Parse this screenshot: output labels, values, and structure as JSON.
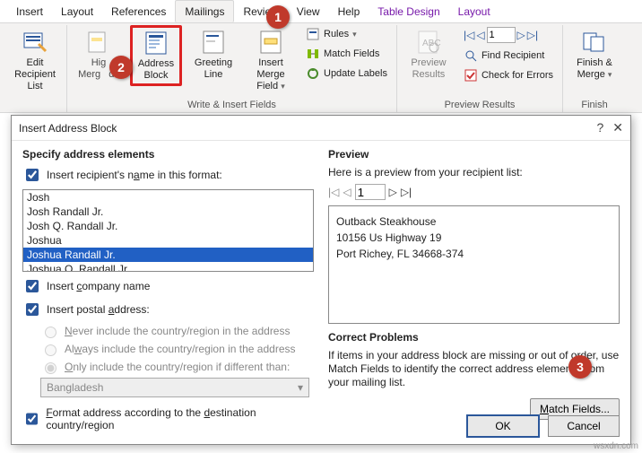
{
  "tabs": {
    "insert": "Insert",
    "layout": "Layout",
    "references": "References",
    "mailings": "Mailings",
    "review": "Review",
    "view": "View",
    "help": "Help",
    "tabledesign": "Table Design",
    "layout2": "Layout"
  },
  "ribbon": {
    "edit_recipient_list": "Edit Recipient List",
    "highlight_merge": "Highlight Merge Fields",
    "address_block": "Address Block",
    "greeting_line": "Greeting Line",
    "insert_merge_field": "Insert Merge Field",
    "rules": "Rules",
    "match_fields": "Match Fields",
    "update_labels": "Update Labels",
    "preview_results": "Preview Results",
    "record_value": "1",
    "find_recipient": "Find Recipient",
    "check_errors": "Check for Errors",
    "finish_merge": "Finish & Merge",
    "group_write": "Write & Insert Fields",
    "group_preview": "Preview Results",
    "group_finish": "Finish"
  },
  "dialog": {
    "title": "Insert Address Block",
    "specify": "Specify address elements",
    "insert_name": "Insert recipient's name in this format:",
    "names": [
      "Josh",
      "Josh Randall Jr.",
      "Josh Q. Randall Jr.",
      "Joshua",
      "Joshua Randall Jr.",
      "Joshua Q. Randall Jr."
    ],
    "selected_name": "Joshua Randall Jr.",
    "insert_company": "Insert company name",
    "insert_postal": "Insert postal address:",
    "radio_never": "Never include the country/region in the address",
    "radio_always": "Always include the country/region in the address",
    "radio_only": "Only include the country/region if different than:",
    "country": "Bangladesh",
    "format_dest": "Format address according to the destination country/region",
    "preview_title": "Preview",
    "preview_note": "Here is a preview from your recipient list:",
    "preview_record": "1",
    "preview_lines": [
      "Outback Steakhouse",
      "10156 Us Highway 19",
      "Port Richey, FL 34668-374"
    ],
    "correct_title": "Correct Problems",
    "correct_text": "If items in your address block are missing or out of order, use Match Fields to identify the correct address elements from your mailing list.",
    "match_fields_btn": "Match Fields...",
    "ok": "OK",
    "cancel": "Cancel"
  },
  "annotations": {
    "n1": "1",
    "n2": "2",
    "n3": "3"
  },
  "watermark": "wsxdn.com"
}
